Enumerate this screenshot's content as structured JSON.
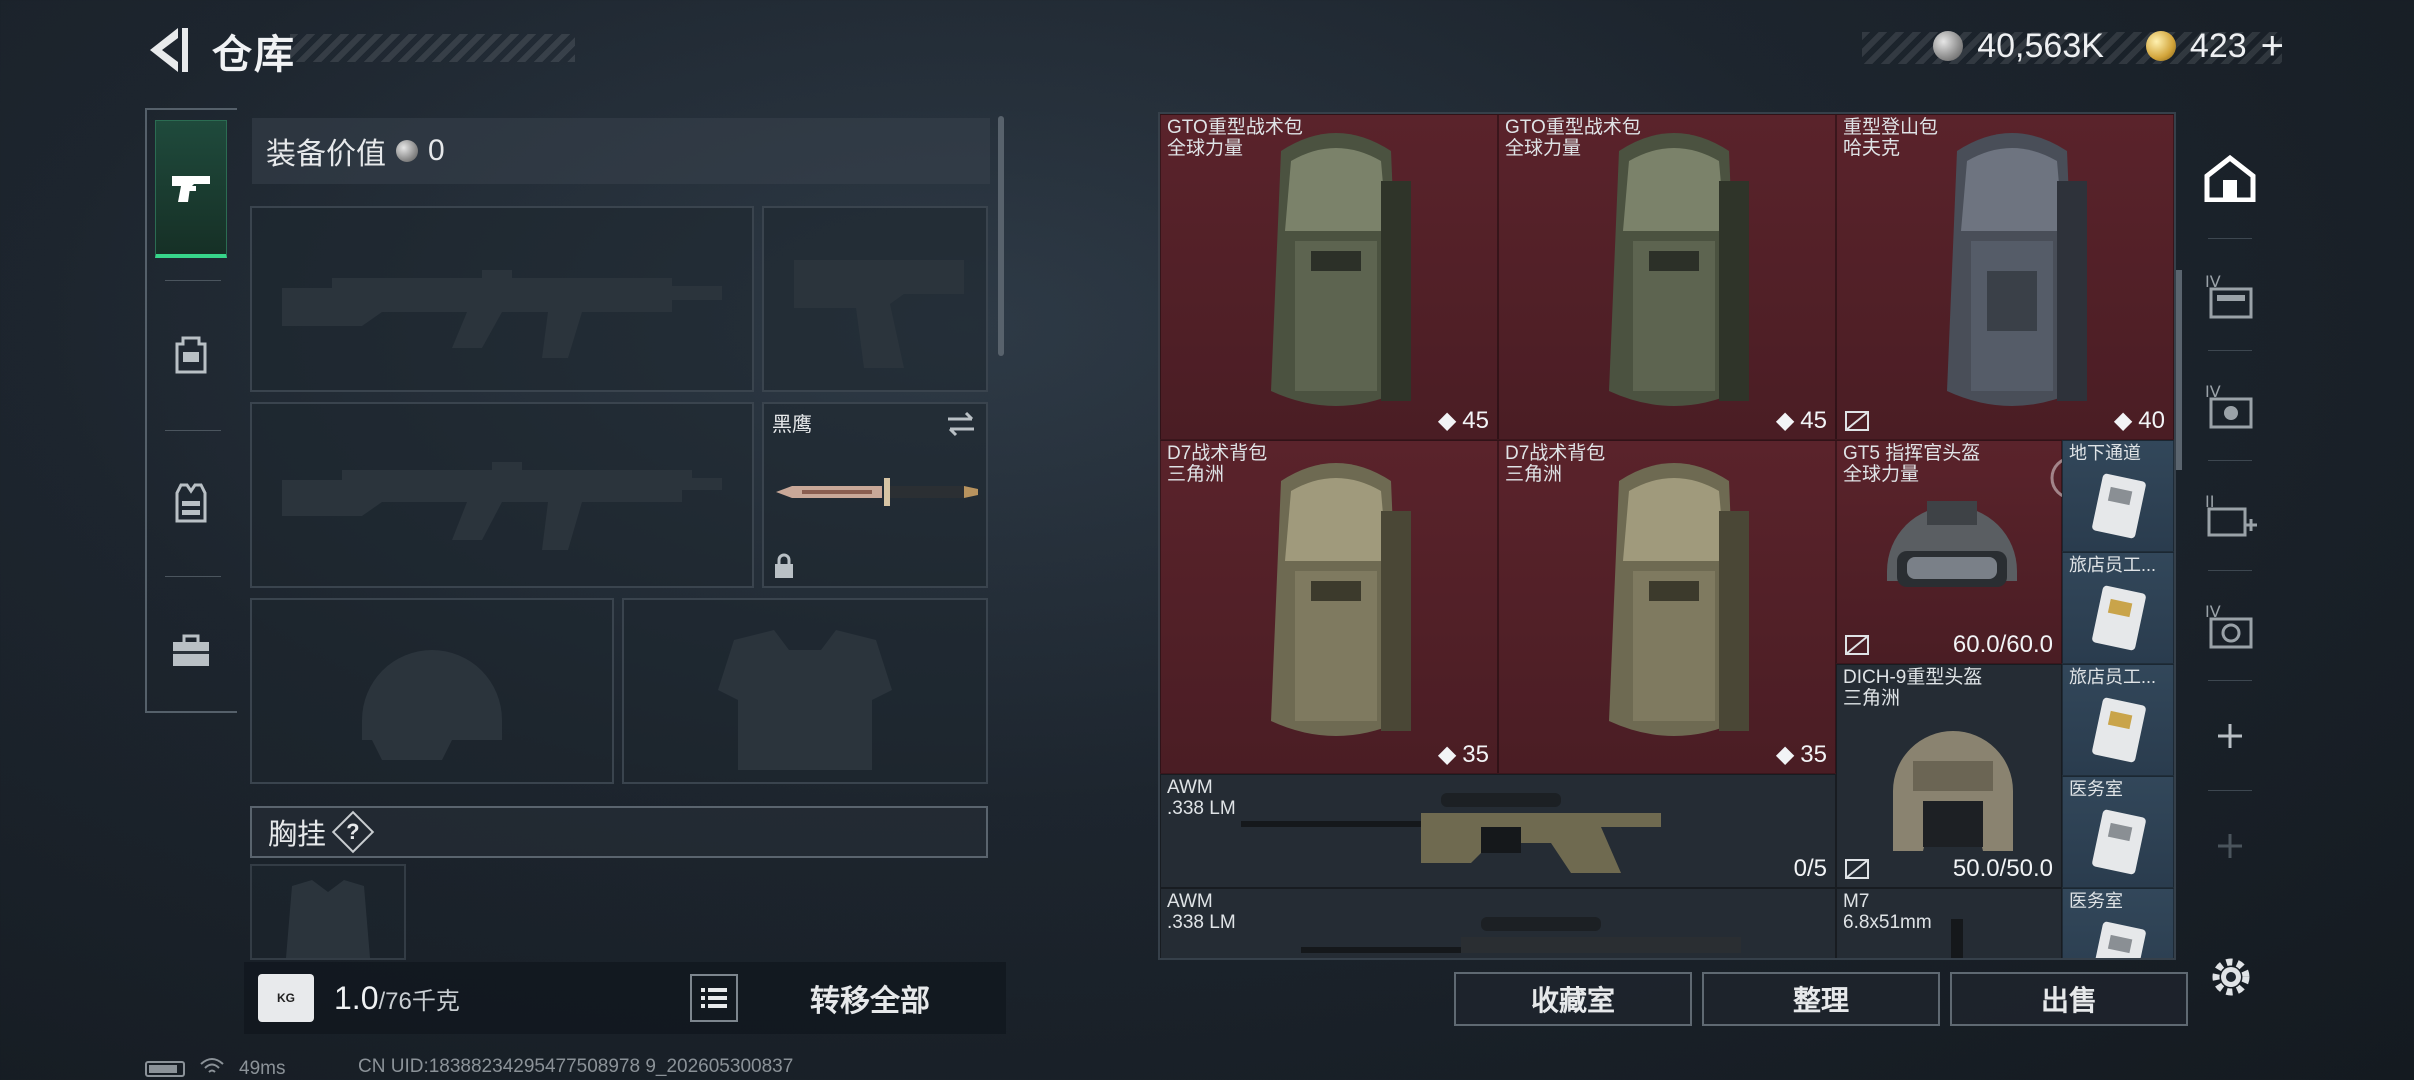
{
  "header": {
    "title": "仓库",
    "currency_silver": "40,563K",
    "currency_gold": "423",
    "add_symbol": "+"
  },
  "rail": {
    "tabs": [
      {
        "name": "tab-weapons",
        "icon": "pistol-icon",
        "active": true
      },
      {
        "name": "tab-backpack",
        "icon": "backpack-icon",
        "active": false
      },
      {
        "name": "tab-vest",
        "icon": "vest-icon",
        "active": false
      },
      {
        "name": "tab-case",
        "icon": "briefcase-icon",
        "active": false
      }
    ]
  },
  "equipment": {
    "value_label": "装备价值",
    "value": "0",
    "knife_name": "黑鹰",
    "chest_label": "胸挂",
    "chest_help": "?",
    "weight_current": "1.0",
    "weight_max": "/76千克",
    "weight_icon_text": "KG",
    "transfer_all": "转移全部"
  },
  "storage": {
    "items": [
      {
        "name_lines": [
          "GTO重型战术包",
          "全球力量"
        ],
        "count": "45",
        "color": "red",
        "kind": "backpack-green"
      },
      {
        "name_lines": [
          "GTO重型战术包",
          "全球力量"
        ],
        "count": "45",
        "color": "red",
        "kind": "backpack-green"
      },
      {
        "name_lines": [
          "重型登山包",
          "哈夫克"
        ],
        "count": "40",
        "color": "red",
        "kind": "backpack-grey"
      },
      {
        "name_lines": [
          "D7战术背包",
          "三角洲"
        ],
        "count": "35",
        "color": "red",
        "kind": "backpack-tan"
      },
      {
        "name_lines": [
          "D7战术背包",
          "三角洲"
        ],
        "count": "35",
        "color": "red",
        "kind": "backpack-tan"
      },
      {
        "name_lines": [
          "GT5 指挥官头盔",
          "全球力量"
        ],
        "durability": "60.0/60.0",
        "color": "red",
        "kind": "helmet"
      },
      {
        "name_lines": [
          "DICH-9重型头盔",
          "三角洲"
        ],
        "durability": "50.0/50.0",
        "color": "dark",
        "kind": "helmet"
      },
      {
        "name_lines": [
          "AWM",
          ".338 LM"
        ],
        "count": "0/5",
        "color": "dark",
        "kind": "rifle"
      },
      {
        "name_lines": [
          "AWM",
          ".338 LM"
        ],
        "count": "",
        "color": "dark",
        "kind": "rifle"
      },
      {
        "name_lines": [
          "M7",
          "6.8x51mm"
        ],
        "count": "",
        "color": "dark",
        "kind": "ammo"
      }
    ],
    "keycards": [
      {
        "label": "地下通道"
      },
      {
        "label": "旅店员工..."
      },
      {
        "label": "旅店员工..."
      },
      {
        "label": "医务室"
      },
      {
        "label": "医务室"
      }
    ]
  },
  "right_rail": {
    "items": [
      "home-icon",
      "storage-iv-icon",
      "storage-iv-2-icon",
      "medkit-plus-icon",
      "storage-iv-3-icon",
      "add-icon",
      "add-icon-dim"
    ]
  },
  "actions": {
    "collection": "收藏室",
    "organize": "整理",
    "sell": "出售"
  },
  "status": {
    "ping": "49ms",
    "uid": "CN UID:18388234295477508978 9_202605300837"
  },
  "colors": {
    "accent_green": "#37d58a",
    "item_red": "#5a232b",
    "item_blue": "#32475a"
  }
}
